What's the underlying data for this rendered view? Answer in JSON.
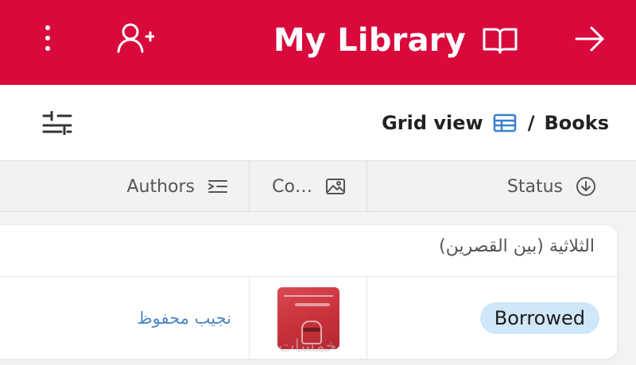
{
  "header": {
    "title": "My Library",
    "bg_color": "#d80a3c",
    "icons": {
      "menu": "more-vertical-icon",
      "add_user": "add-person-icon",
      "title_icon": "book-icon",
      "nav": "arrow-right-icon"
    }
  },
  "toolbar": {
    "filter_icon": "sliders-icon",
    "breadcrumb": {
      "view_label": "Grid view",
      "view_icon": "grid-table-icon",
      "separator": "/",
      "table_label": "Books"
    }
  },
  "columns": [
    {
      "label": "Authors",
      "icon": "text-field-icon"
    },
    {
      "label": "Co…",
      "icon": "image-icon"
    },
    {
      "label": "Status",
      "icon": "circle-arrow-down-icon"
    }
  ],
  "group": {
    "title": "الثلاثية (بين القصرين)",
    "rows": [
      {
        "author": "نجيب محفوظ",
        "cover": "book-cover-image",
        "status": "Borrowed"
      }
    ]
  },
  "watermark": "خمسات",
  "colors": {
    "badge": "#cfe7f8",
    "author_link": "#4a86c8"
  }
}
